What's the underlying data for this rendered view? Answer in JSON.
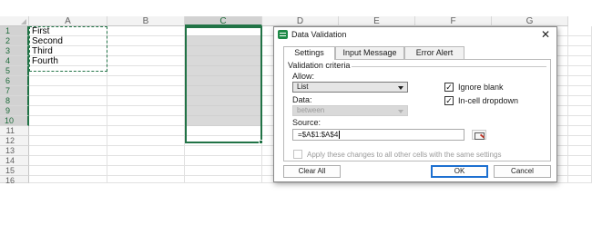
{
  "sheet": {
    "columns": [
      "A",
      "B",
      "C",
      "D",
      "E",
      "F",
      "G"
    ],
    "rows": [
      "1",
      "2",
      "3",
      "4",
      "5",
      "6",
      "7",
      "8",
      "9",
      "10",
      "11",
      "12",
      "13",
      "14",
      "15",
      "16"
    ],
    "column_a_values": [
      "First",
      "Second",
      "Third",
      "Fourth"
    ],
    "selected_column": "C",
    "accent_color": "#217346"
  },
  "dialog": {
    "title": "Data Validation",
    "close_glyph": "✕",
    "icon": "excel-app-icon",
    "tabs": [
      "Settings",
      "Input Message",
      "Error Alert"
    ],
    "active_tab": "Settings",
    "criteria_legend": "Validation criteria",
    "allow_label": "Allow:",
    "allow_value": "List",
    "data_label": "Data:",
    "data_value": "between",
    "ignore_blank_label": "Ignore blank",
    "ignore_blank_checked": "✓",
    "in_cell_dropdown_label": "In-cell dropdown",
    "in_cell_dropdown_checked": "✓",
    "source_label": "Source:",
    "source_value": "=$A$1:$A$4",
    "apply_all_label": "Apply these changes to all other cells with the same settings",
    "clear_all_label": "Clear All",
    "ok_label": "OK",
    "cancel_label": "Cancel"
  }
}
